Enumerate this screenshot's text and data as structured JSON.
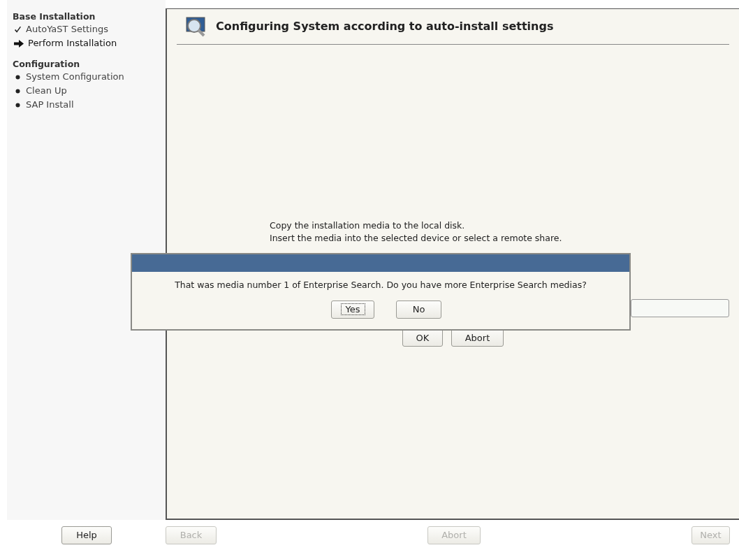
{
  "sidebar": {
    "sections": [
      {
        "heading": "Base Installation",
        "items": [
          {
            "label": "AutoYaST Settings",
            "kind": "done"
          },
          {
            "label": "Perform Installation",
            "kind": "current"
          }
        ]
      },
      {
        "heading": "Configuration",
        "items": [
          {
            "label": "System Configuration",
            "kind": "pending"
          },
          {
            "label": "Clean Up",
            "kind": "pending"
          },
          {
            "label": "SAP Install",
            "kind": "pending"
          }
        ]
      }
    ]
  },
  "main": {
    "title": "Configuring System according to auto-install settings",
    "message_lines": [
      "Copy the installation media to the local disk.",
      "Insert the media into the selected device or select a remote share."
    ],
    "buttons": [
      {
        "label": "OK",
        "disabled": false
      },
      {
        "label": "Abort",
        "disabled": false
      }
    ]
  },
  "popup": {
    "message": "That was media number 1 of Enterprise Search. Do you have more Enterprise Search medias?",
    "buttons": [
      {
        "label": "Yes",
        "focused": true
      },
      {
        "label": "No",
        "focused": false
      }
    ]
  },
  "footer": {
    "buttons": [
      {
        "label": "Help",
        "disabled": false
      },
      {
        "label": "Back",
        "disabled": true
      },
      {
        "label": "Abort",
        "disabled": true
      },
      {
        "label": "Next",
        "disabled": true
      }
    ]
  }
}
